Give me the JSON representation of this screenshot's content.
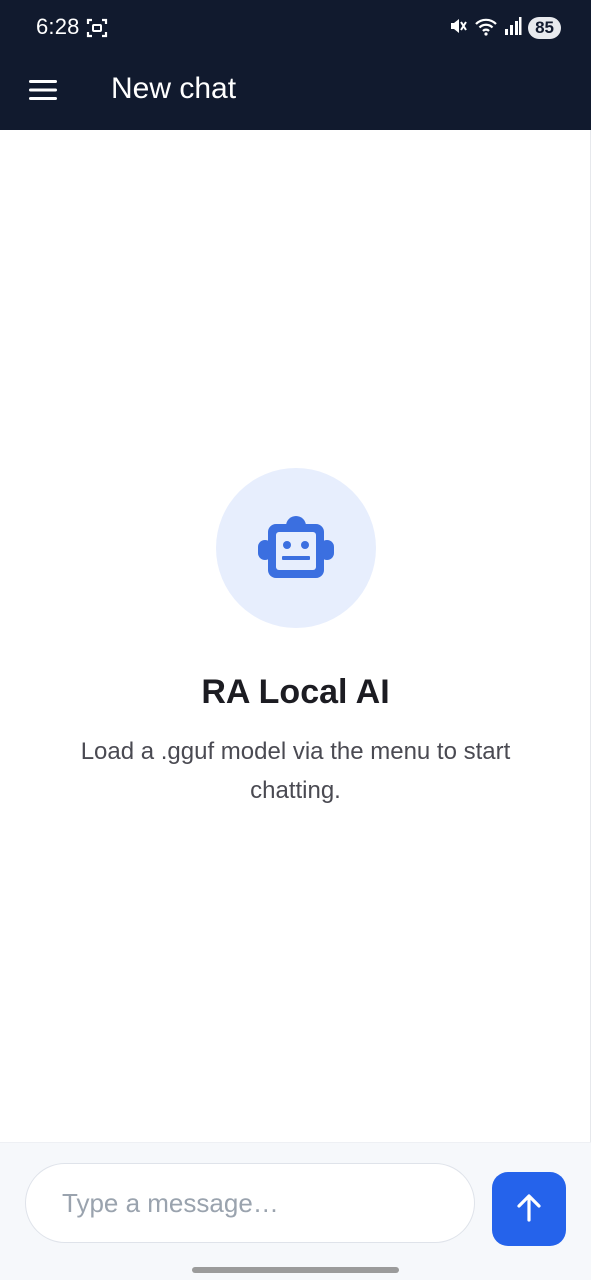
{
  "status_bar": {
    "time": "6:28",
    "battery": "85",
    "icons": [
      "screenshot-icon",
      "mute-icon",
      "wifi-icon",
      "signal-icon"
    ]
  },
  "app_bar": {
    "title": "New chat",
    "menu_icon": "hamburger-menu-icon"
  },
  "empty_state": {
    "icon": "robot-icon",
    "title": "RA Local AI",
    "subtitle": "Load a .gguf model via the menu to start chatting."
  },
  "composer": {
    "placeholder": "Type a message…",
    "value": "",
    "send_icon": "arrow-up-icon"
  },
  "colors": {
    "header_bg": "#111a2e",
    "accent": "#2563eb",
    "icon_circle_bg": "#e7eefd",
    "robot_blue": "#3b6fe0"
  }
}
